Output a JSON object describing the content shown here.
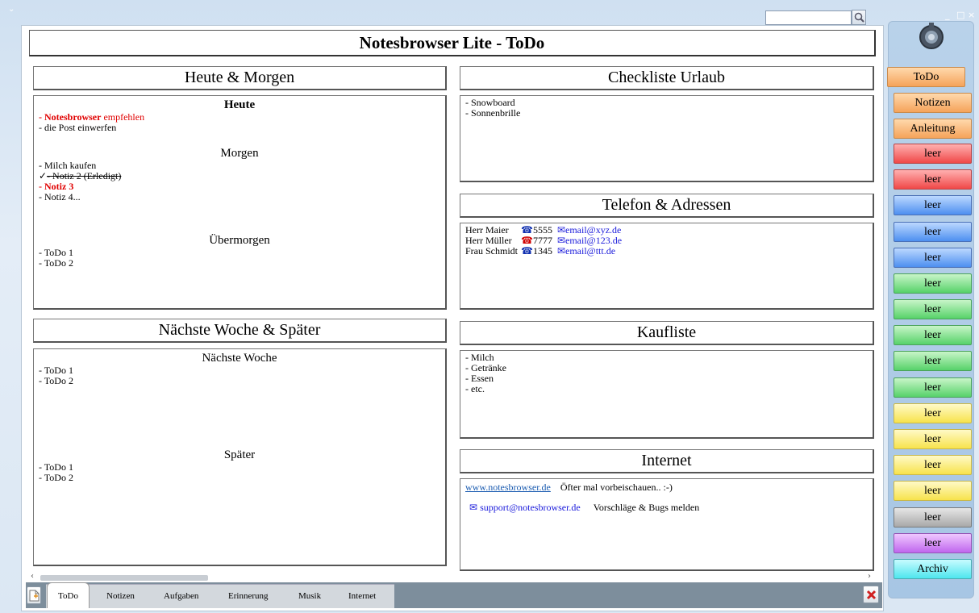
{
  "app": {
    "title": "Notesbrowser Lite - ToDo"
  },
  "window": {
    "controls": [
      "_",
      "□",
      "×"
    ]
  },
  "search": {
    "placeholder": ""
  },
  "sections": {
    "heute_morgen": {
      "title": "Heute & Morgen",
      "heute_label": "Heute",
      "heute_item1_bold": "- Notesbrowser",
      "heute_item1_rest": " empfehlen",
      "heute_item2": "- die Post einwerfen",
      "morgen_label": "Morgen",
      "morgen_item1": "- Milch kaufen",
      "morgen_item2_check": "✓",
      "morgen_item2": "- Notiz 2 (Erledigt)",
      "morgen_item3": "- Notiz 3",
      "morgen_item4": "- Notiz 4...",
      "uebermorgen_label": "Übermorgen",
      "uebermorgen_items": [
        "- ToDo 1",
        "- ToDo 2"
      ]
    },
    "naechste_woche": {
      "title": "Nächste Woche & Später",
      "woche_label": "Nächste Woche",
      "woche_items": [
        "- ToDo 1",
        "- ToDo 2"
      ],
      "spaeter_label": "Später",
      "spaeter_items": [
        "- ToDo 1",
        "- ToDo 2"
      ]
    },
    "checkliste": {
      "title": "Checkliste Urlaub",
      "items": [
        "- Snowboard",
        "- Sonnenbrille"
      ]
    },
    "telefon": {
      "title": "Telefon & Adressen",
      "contacts": [
        {
          "name": "Herr Maier",
          "phone": "5555",
          "email": "email@xyz.de",
          "phone_color": "#1030b0"
        },
        {
          "name": "Herr Müller",
          "phone": "7777",
          "email": "email@123.de",
          "phone_color": "#d00000"
        },
        {
          "name": "Frau Schmidt",
          "phone": "1345",
          "email": "email@ttt.de",
          "phone_color": "#1030b0"
        }
      ]
    },
    "kaufliste": {
      "title": "Kaufliste",
      "items": [
        "- Milch",
        "- Getränke",
        "- Essen",
        "- etc."
      ]
    },
    "internet": {
      "title": "Internet",
      "link": "www.notesbrowser.de",
      "link_note": "Öfter mal vorbeischauen.. :-)",
      "support_email": "support@notesbrowser.de",
      "support_note": "Vorschläge & Bugs melden"
    }
  },
  "tabs": [
    "ToDo",
    "Notizen",
    "Aufgaben",
    "Erinnerung",
    "Musik",
    "Internet"
  ],
  "sidebar": {
    "buttons": [
      {
        "label": "ToDo",
        "color": "orange"
      },
      {
        "label": "Notizen",
        "color": "orange"
      },
      {
        "label": "Anleitung",
        "color": "orange"
      },
      {
        "label": "leer",
        "color": "red"
      },
      {
        "label": "leer",
        "color": "red"
      },
      {
        "label": "leer",
        "color": "blue"
      },
      {
        "label": "leer",
        "color": "blue"
      },
      {
        "label": "leer",
        "color": "blue"
      },
      {
        "label": "leer",
        "color": "green"
      },
      {
        "label": "leer",
        "color": "green"
      },
      {
        "label": "leer",
        "color": "green"
      },
      {
        "label": "leer",
        "color": "green"
      },
      {
        "label": "leer",
        "color": "green"
      },
      {
        "label": "leer",
        "color": "yellow"
      },
      {
        "label": "leer",
        "color": "yellow"
      },
      {
        "label": "leer",
        "color": "yellow"
      },
      {
        "label": "leer",
        "color": "yellow"
      },
      {
        "label": "leer",
        "color": "gray"
      },
      {
        "label": "leer",
        "color": "purple"
      },
      {
        "label": "Archiv",
        "color": "cyan"
      }
    ]
  }
}
